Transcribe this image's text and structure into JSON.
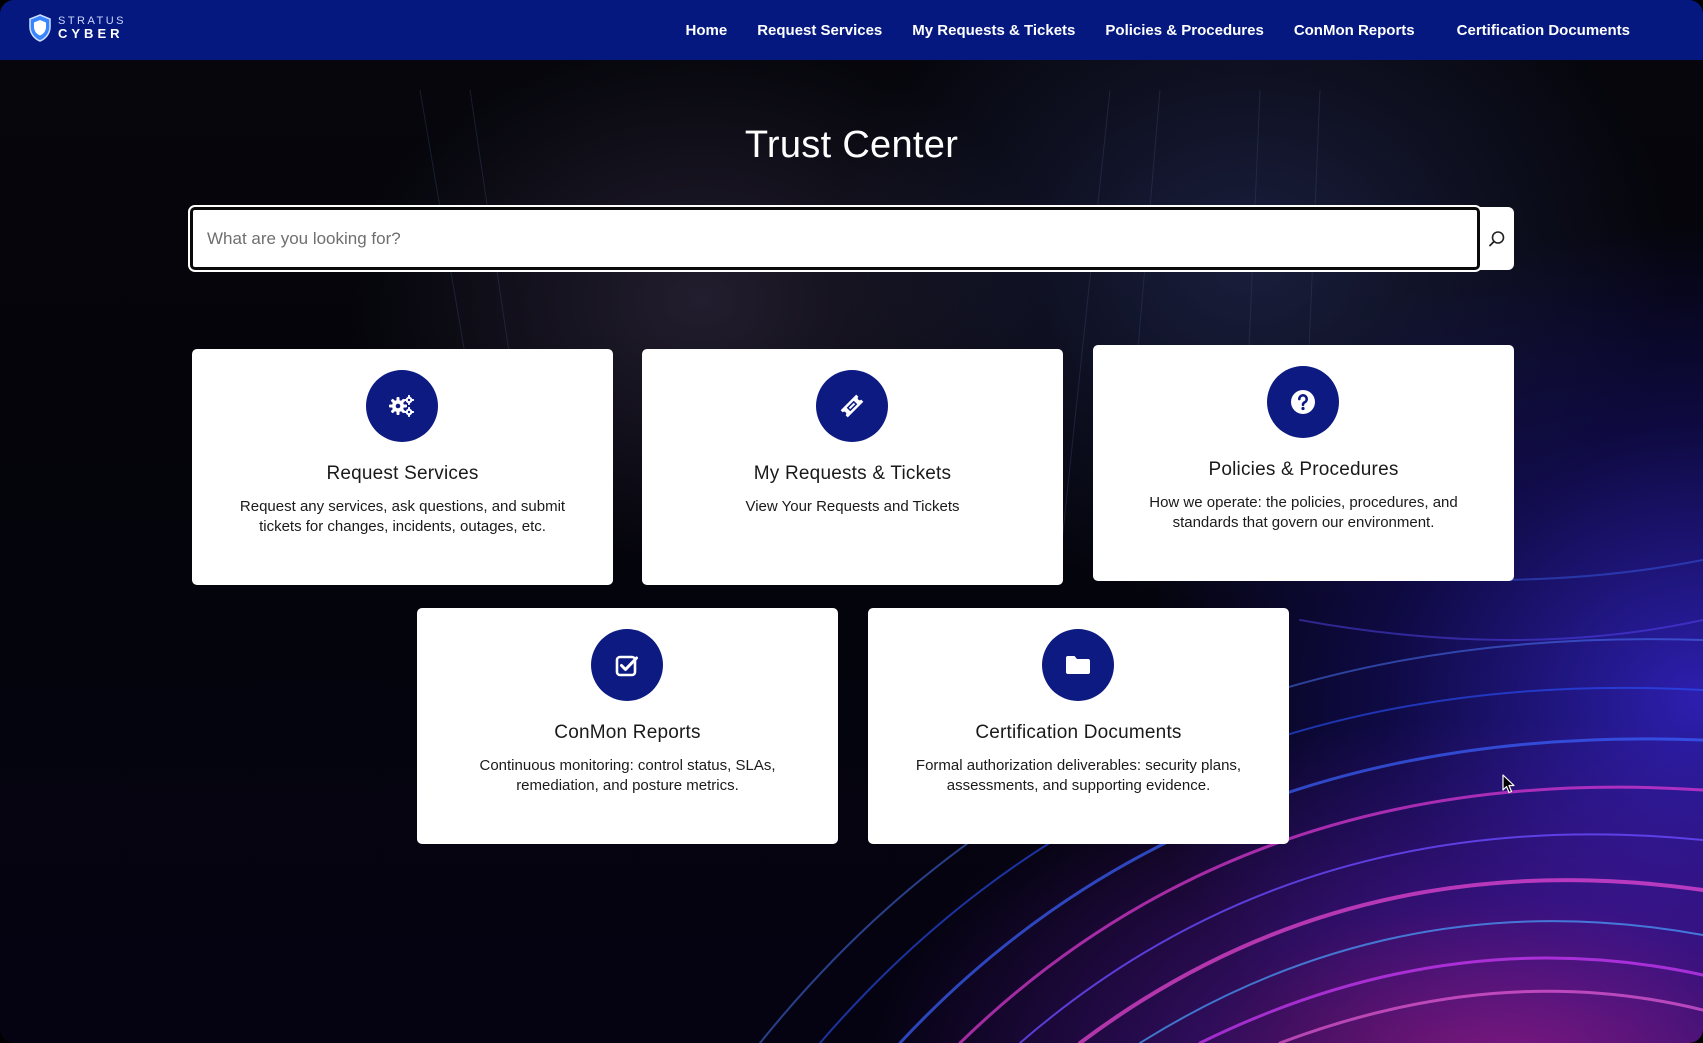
{
  "brand": {
    "top": "STRATUS",
    "bottom": "CYBER",
    "color": "#04187f"
  },
  "nav": {
    "items": [
      {
        "label": "Home"
      },
      {
        "label": "Request Services"
      },
      {
        "label": "My Requests & Tickets"
      },
      {
        "label": "Policies & Procedures"
      },
      {
        "label": "ConMon Reports"
      },
      {
        "label": "Certification Documents"
      }
    ]
  },
  "hero": {
    "title": "Trust Center",
    "search_placeholder": "What are you looking for?",
    "search_icon": "search-icon"
  },
  "cards": [
    {
      "title": "Request Services",
      "desc": "Request any services, ask questions, and submit tickets for changes, incidents, outages, etc.",
      "icon": "gears-icon"
    },
    {
      "title": "My Requests & Tickets",
      "desc": "View Your Requests and Tickets",
      "icon": "ticket-icon"
    },
    {
      "title": "Policies & Procedures",
      "desc": "How we operate: the policies, procedures, and standards that govern our environment.",
      "icon": "question-icon"
    },
    {
      "title": "ConMon Reports",
      "desc": "Continuous monitoring: control status, SLAs, remediation, and posture metrics.",
      "icon": "checkbox-icon"
    },
    {
      "title": "Certification Documents",
      "desc": "Formal authorization deliverables: security plans, assessments, and supporting evidence.",
      "icon": "folder-icon"
    }
  ],
  "colors": {
    "accent": "#0c1a82",
    "card_bg": "#ffffff"
  }
}
